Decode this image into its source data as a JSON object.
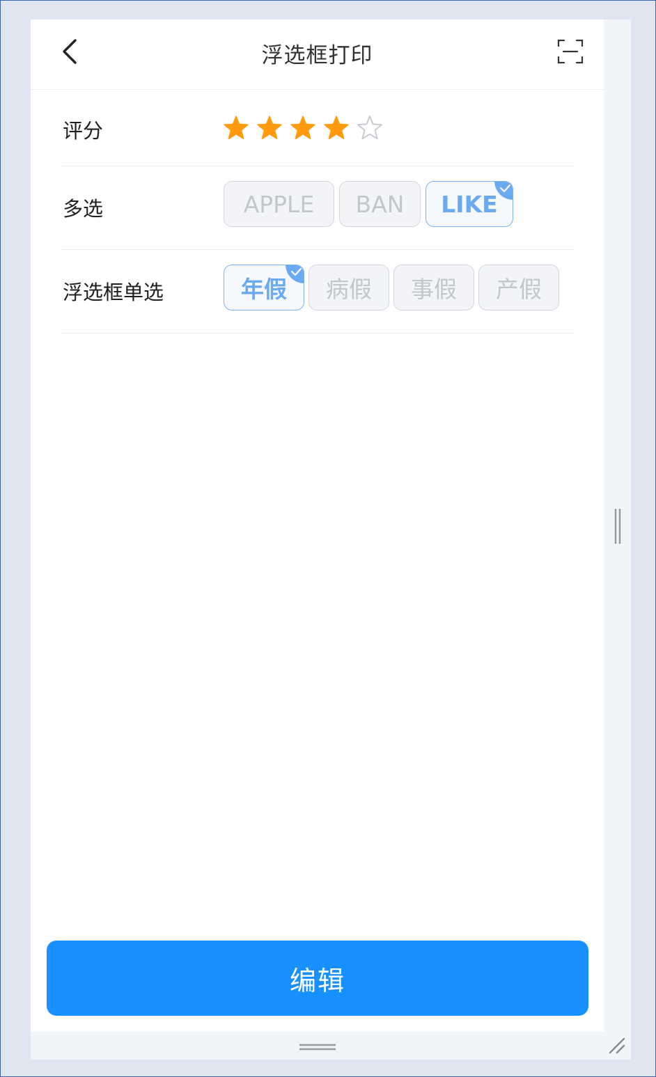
{
  "header": {
    "title": "浮选框打印"
  },
  "rating": {
    "label": "评分",
    "value": 4,
    "max": 5,
    "filled_color": "#ff9a0d",
    "empty_color": "#c8ccd2"
  },
  "multi": {
    "label": "多选",
    "options": [
      {
        "label": "APPLE",
        "selected": false
      },
      {
        "label": "BAN",
        "selected": false
      },
      {
        "label": "LIKE",
        "selected": true
      }
    ]
  },
  "single": {
    "label": "浮选框单选",
    "options": [
      {
        "label": "年假",
        "selected": true
      },
      {
        "label": "病假",
        "selected": false
      },
      {
        "label": "事假",
        "selected": false
      },
      {
        "label": "产假",
        "selected": false
      }
    ]
  },
  "footer": {
    "edit_label": "编辑"
  },
  "colors": {
    "primary": "#1890ff",
    "selected_text": "#6aaaf0"
  }
}
